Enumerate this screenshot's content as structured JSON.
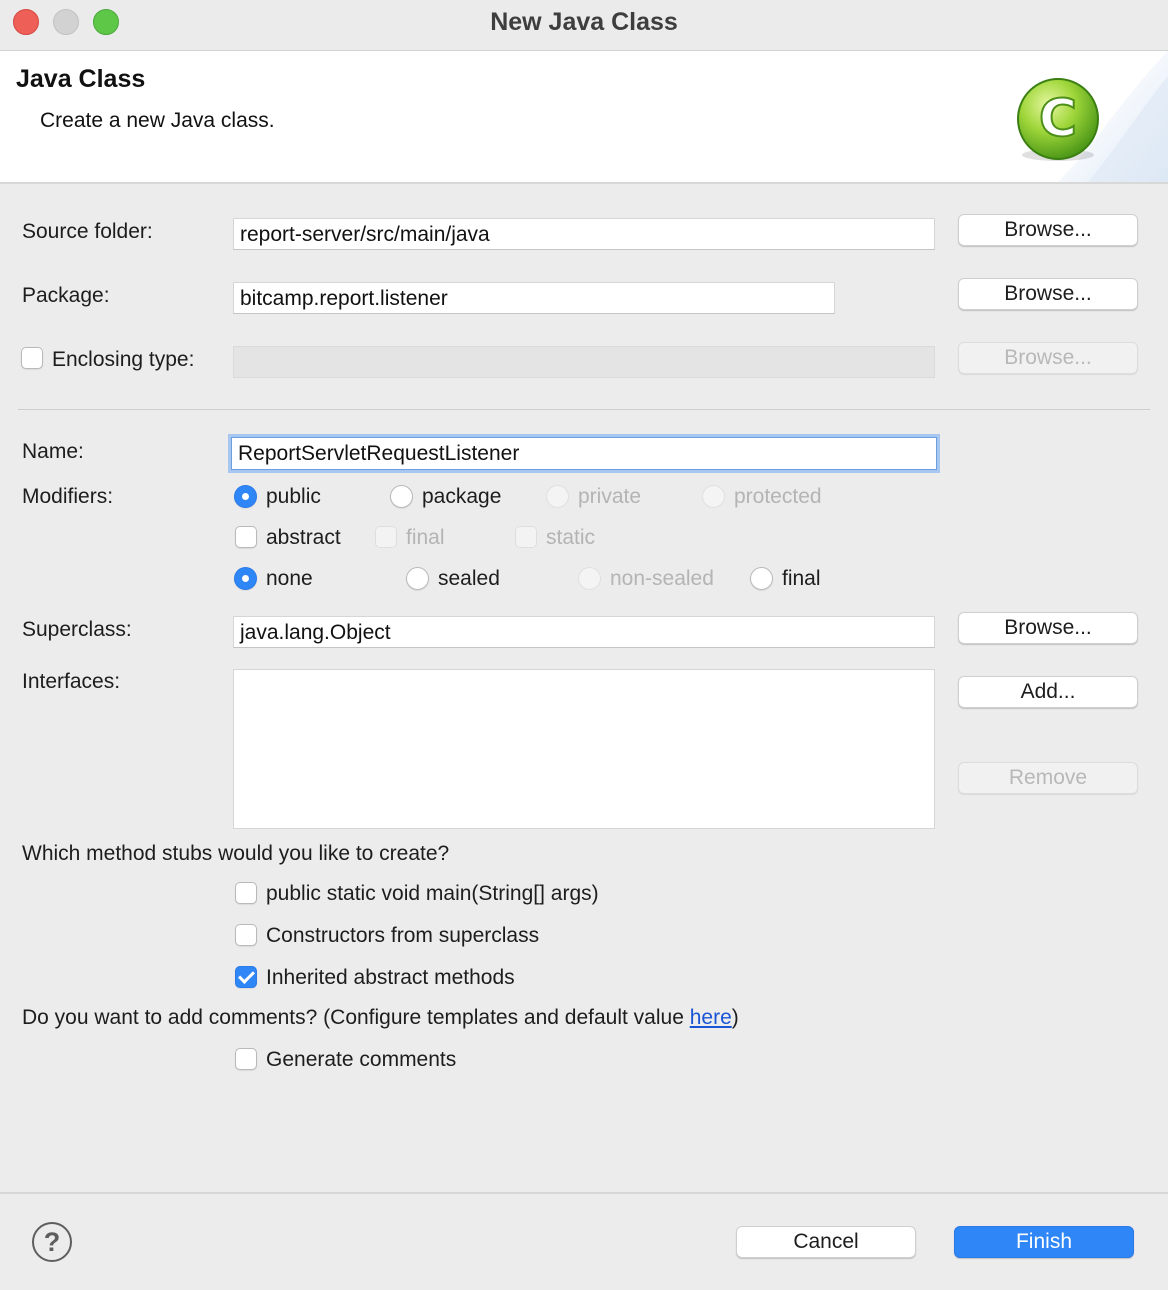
{
  "window": {
    "title": "New Java Class"
  },
  "banner": {
    "title": "Java Class",
    "description": "Create a new Java class.",
    "icon": "java-class-icon",
    "icon_letter": "C"
  },
  "source_folder": {
    "label": "Source folder:",
    "value": "report-server/src/main/java",
    "browse_label": "Browse..."
  },
  "package": {
    "label": "Package:",
    "value": "bitcamp.report.listener",
    "browse_label": "Browse..."
  },
  "enclosing_type": {
    "label": "Enclosing type:",
    "checked": false,
    "value": "",
    "browse_label": "Browse..."
  },
  "name": {
    "label": "Name:",
    "value": "ReportServletRequestListener"
  },
  "modifiers": {
    "label": "Modifiers:",
    "access": [
      {
        "label": "public",
        "selected": true,
        "enabled": true
      },
      {
        "label": "package",
        "selected": false,
        "enabled": true
      },
      {
        "label": "private",
        "selected": false,
        "enabled": false
      },
      {
        "label": "protected",
        "selected": false,
        "enabled": false
      }
    ],
    "flags": [
      {
        "label": "abstract",
        "checked": false,
        "enabled": true
      },
      {
        "label": "final",
        "checked": false,
        "enabled": false
      },
      {
        "label": "static",
        "checked": false,
        "enabled": false
      }
    ],
    "sealing": [
      {
        "label": "none",
        "selected": true,
        "enabled": true
      },
      {
        "label": "sealed",
        "selected": false,
        "enabled": true
      },
      {
        "label": "non-sealed",
        "selected": false,
        "enabled": false
      },
      {
        "label": "final",
        "selected": false,
        "enabled": true
      }
    ]
  },
  "superclass": {
    "label": "Superclass:",
    "value": "java.lang.Object",
    "browse_label": "Browse..."
  },
  "interfaces": {
    "label": "Interfaces:",
    "items": [],
    "add_label": "Add...",
    "remove_label": "Remove"
  },
  "stubs": {
    "question": "Which method stubs would you like to create?",
    "options": [
      {
        "label": "public static void main(String[] args)",
        "checked": false
      },
      {
        "label": "Constructors from superclass",
        "checked": false
      },
      {
        "label": "Inherited abstract methods",
        "checked": true
      }
    ]
  },
  "comments": {
    "question_prefix": "Do you want to add comments? (Configure templates and default value ",
    "link_text": "here",
    "question_suffix": ")",
    "generate_label": "Generate comments",
    "generate_checked": false
  },
  "footer": {
    "help_label": "?",
    "cancel_label": "Cancel",
    "finish_label": "Finish"
  },
  "colors": {
    "accent": "#2f86f6",
    "link": "#1a55d6"
  }
}
